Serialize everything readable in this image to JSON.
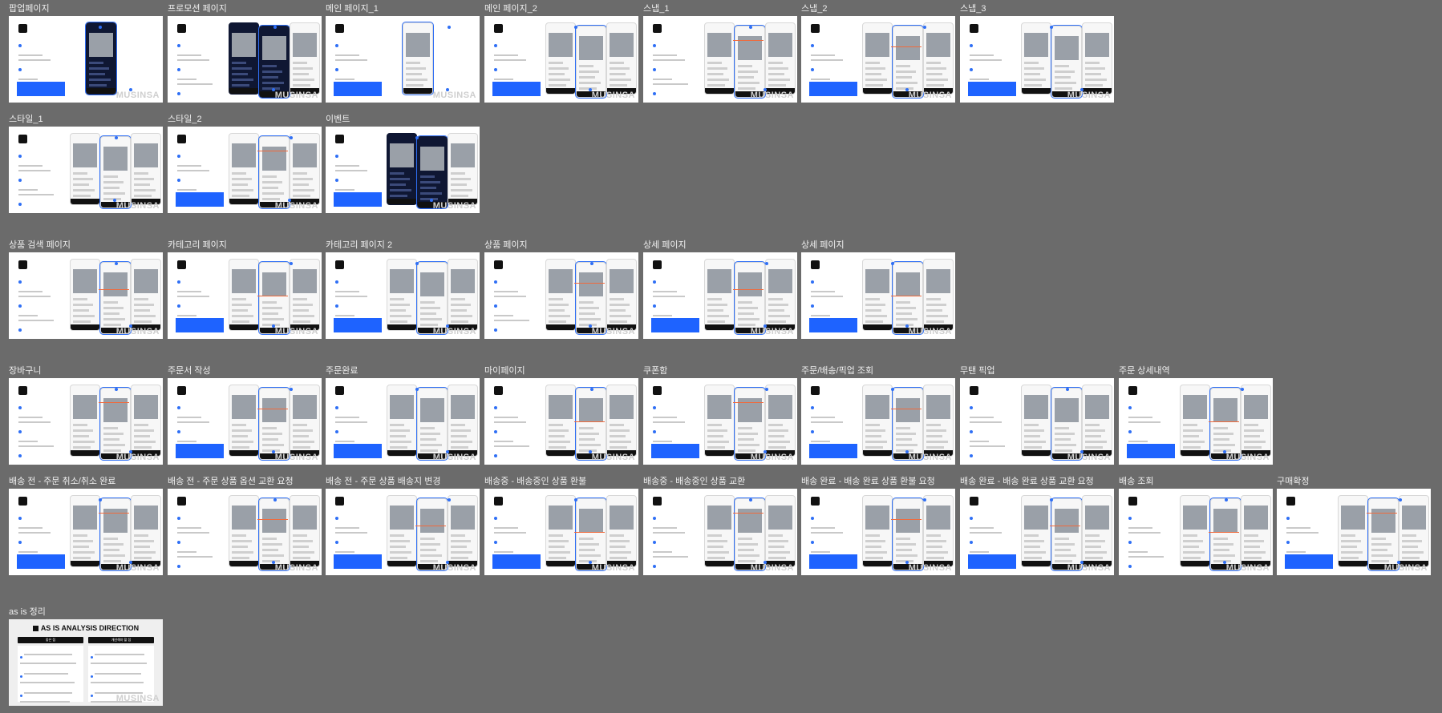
{
  "canvas_background": "#6b6b6b",
  "accent_color": "#2f6ff5",
  "brand_watermark": "MUSINSA",
  "frames": [
    {
      "label": "팝업페이지",
      "style": "dark-single"
    },
    {
      "label": "프로모션 페이지",
      "style": "dark-multi"
    },
    {
      "label": "메인 페이지_1",
      "style": "single"
    },
    {
      "label": "메인 페이지_2",
      "style": "photo"
    },
    {
      "label": "스냅_1",
      "style": "multi"
    },
    {
      "label": "스냅_2",
      "style": "multi"
    },
    {
      "label": "스냅_3",
      "style": "photo"
    },
    {
      "label": "스타일_1",
      "style": "photo"
    },
    {
      "label": "스타일_2",
      "style": "multi"
    },
    {
      "label": "이벤트",
      "style": "dark-multi"
    },
    {
      "label": "상품 검색 페이지",
      "style": "multi"
    },
    {
      "label": "카테고리 페이지",
      "style": "multi"
    },
    {
      "label": "카테고리 페이지 2",
      "style": "photo"
    },
    {
      "label": "상품 페이지",
      "style": "multi"
    },
    {
      "label": "상세 페이지",
      "style": "multi"
    },
    {
      "label": "상세 페이지",
      "style": "multi"
    },
    {
      "label": "장바구니",
      "style": "multi"
    },
    {
      "label": "주문서 작성",
      "style": "multi"
    },
    {
      "label": "주문완료",
      "style": "photo"
    },
    {
      "label": "마이페이지",
      "style": "multi"
    },
    {
      "label": "쿠폰함",
      "style": "multi"
    },
    {
      "label": "주문/배송/픽업 조회",
      "style": "multi"
    },
    {
      "label": "무탠 픽업",
      "style": "photo"
    },
    {
      "label": "주문 상세내역",
      "style": "multi"
    },
    {
      "label": "배송 전 - 주문 취소/취소 완료",
      "style": "multi"
    },
    {
      "label": "배송 전 - 주문 상품 옵션 교환 요청",
      "style": "multi"
    },
    {
      "label": "배송 전 - 주문 상품 배송지 변경",
      "style": "multi"
    },
    {
      "label": "배송중 - 배송중인 상품 환불",
      "style": "multi"
    },
    {
      "label": "배송중 - 배송중인 상품 교환",
      "style": "multi"
    },
    {
      "label": "배송 완료 - 배송 완료 상품 환불 요청",
      "style": "multi"
    },
    {
      "label": "배송 완료 - 배송 완료 상품 교환 요청",
      "style": "multi"
    },
    {
      "label": "배송 조회",
      "style": "multi"
    },
    {
      "label": "구매확정",
      "style": "multi"
    }
  ],
  "analysis_frame": {
    "label": "as is 정리",
    "title": "AS IS ANALYSIS DIRECTION",
    "left_heading": "좋은 점",
    "right_heading": "개선해야 할 점"
  }
}
